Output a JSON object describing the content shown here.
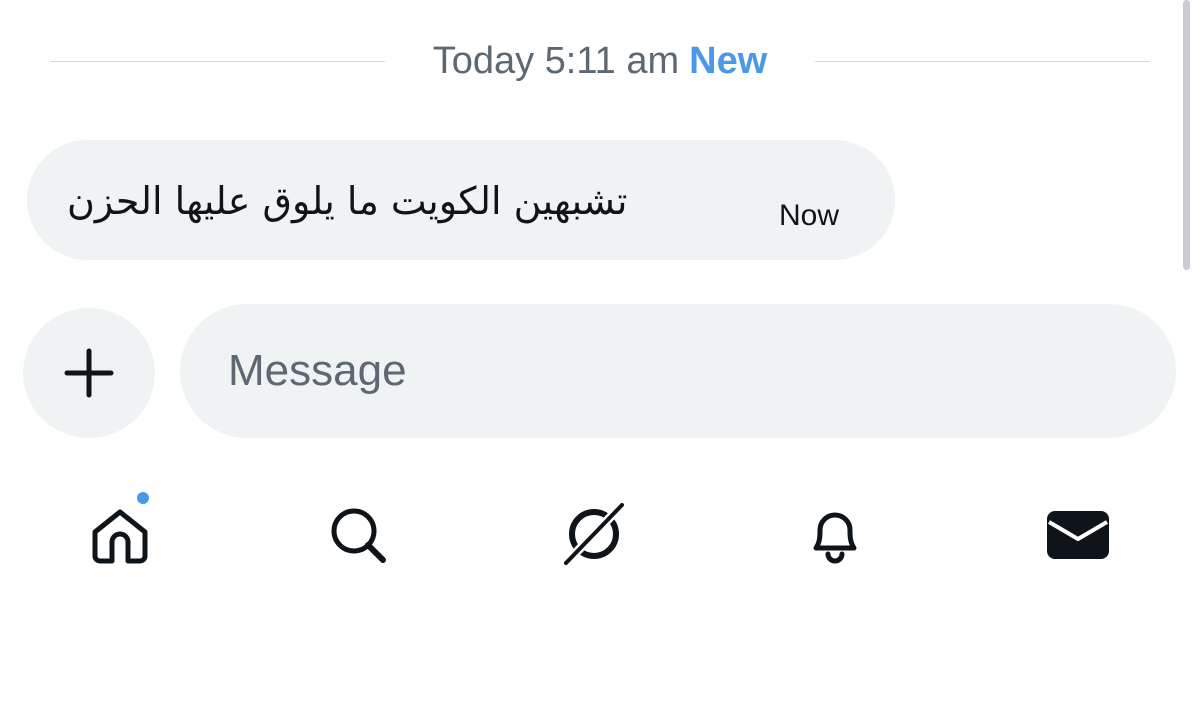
{
  "separator": {
    "date_label": "Today 5:11 am",
    "new_label": "New"
  },
  "message": {
    "text": "تشبهين الكويت ما يلوق عليها الحزن",
    "time": "Now"
  },
  "composer": {
    "add_icon": "plus-icon",
    "placeholder": "Message",
    "value": ""
  },
  "nav": {
    "items": [
      {
        "id": "home",
        "icon": "home-icon",
        "has_notification_dot": true
      },
      {
        "id": "search",
        "icon": "search-icon",
        "has_notification_dot": false
      },
      {
        "id": "grok",
        "icon": "grok-icon",
        "has_notification_dot": false
      },
      {
        "id": "notifications",
        "icon": "bell-icon",
        "has_notification_dot": false
      },
      {
        "id": "messages",
        "icon": "envelope-icon",
        "has_notification_dot": false
      }
    ]
  },
  "colors": {
    "accent": "#4a99e9",
    "bubble_bg": "#eff3f4",
    "text_primary": "#0f1419",
    "text_secondary": "#5d6873"
  }
}
